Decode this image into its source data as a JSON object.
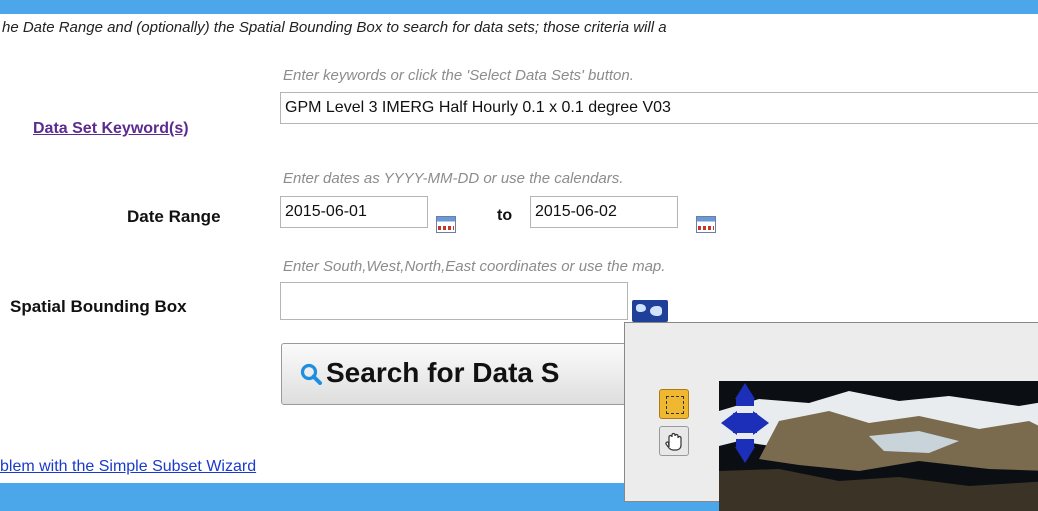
{
  "intro_text": "he Date Range and (optionally) the Spatial Bounding Box to search for data sets; those criteria will a",
  "keyword": {
    "label": "Data Set Keyword(s)",
    "hint": "Enter keywords or click the 'Select Data Sets' button.",
    "value": "GPM Level 3 IMERG Half Hourly 0.1 x 0.1 degree V03"
  },
  "date_range": {
    "label": "Date Range",
    "hint": "Enter dates as YYYY-MM-DD or use the calendars.",
    "start": "2015-06-01",
    "to_label": "to",
    "end": "2015-06-02"
  },
  "bbox": {
    "label": "Spatial Bounding Box",
    "hint": "Enter South,West,North,East coordinates or use the map.",
    "value": ""
  },
  "search_button": {
    "label": "Search for Data S"
  },
  "wizard_link": "blem with the Simple Subset Wizard",
  "colors": {
    "background": "#4ca6ea",
    "link": "#1a3acb",
    "visited_link": "#5b2b8f",
    "hint": "#8c8c8c",
    "map_nav": "#1b2fb8",
    "box_tool": "#f0b830"
  }
}
